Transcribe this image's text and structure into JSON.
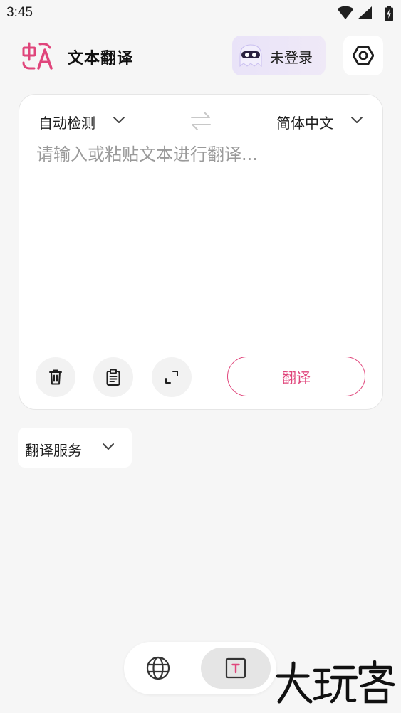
{
  "status_bar": {
    "time": "3:45"
  },
  "header": {
    "title": "文本翻译",
    "login_label": "未登录",
    "logo_icon": "translate-logo-icon",
    "settings_icon": "hexagon-settings-icon"
  },
  "translator": {
    "source_lang": "自动检测",
    "target_lang": "简体中文",
    "swap_icon": "swap-arrows-icon",
    "input_placeholder": "请输入或粘贴文本进行翻译...",
    "input_value": "",
    "translate_label": "翻译"
  },
  "service": {
    "label": "翻译服务"
  },
  "bottom_nav": {
    "items": [
      {
        "icon": "globe-icon",
        "active": false
      },
      {
        "icon": "text-box-icon",
        "active": true
      }
    ]
  },
  "watermark": {
    "text": "大玩客"
  },
  "colors": {
    "accent": "#e0457b",
    "background": "#f6f6f6",
    "card": "#ffffff"
  }
}
